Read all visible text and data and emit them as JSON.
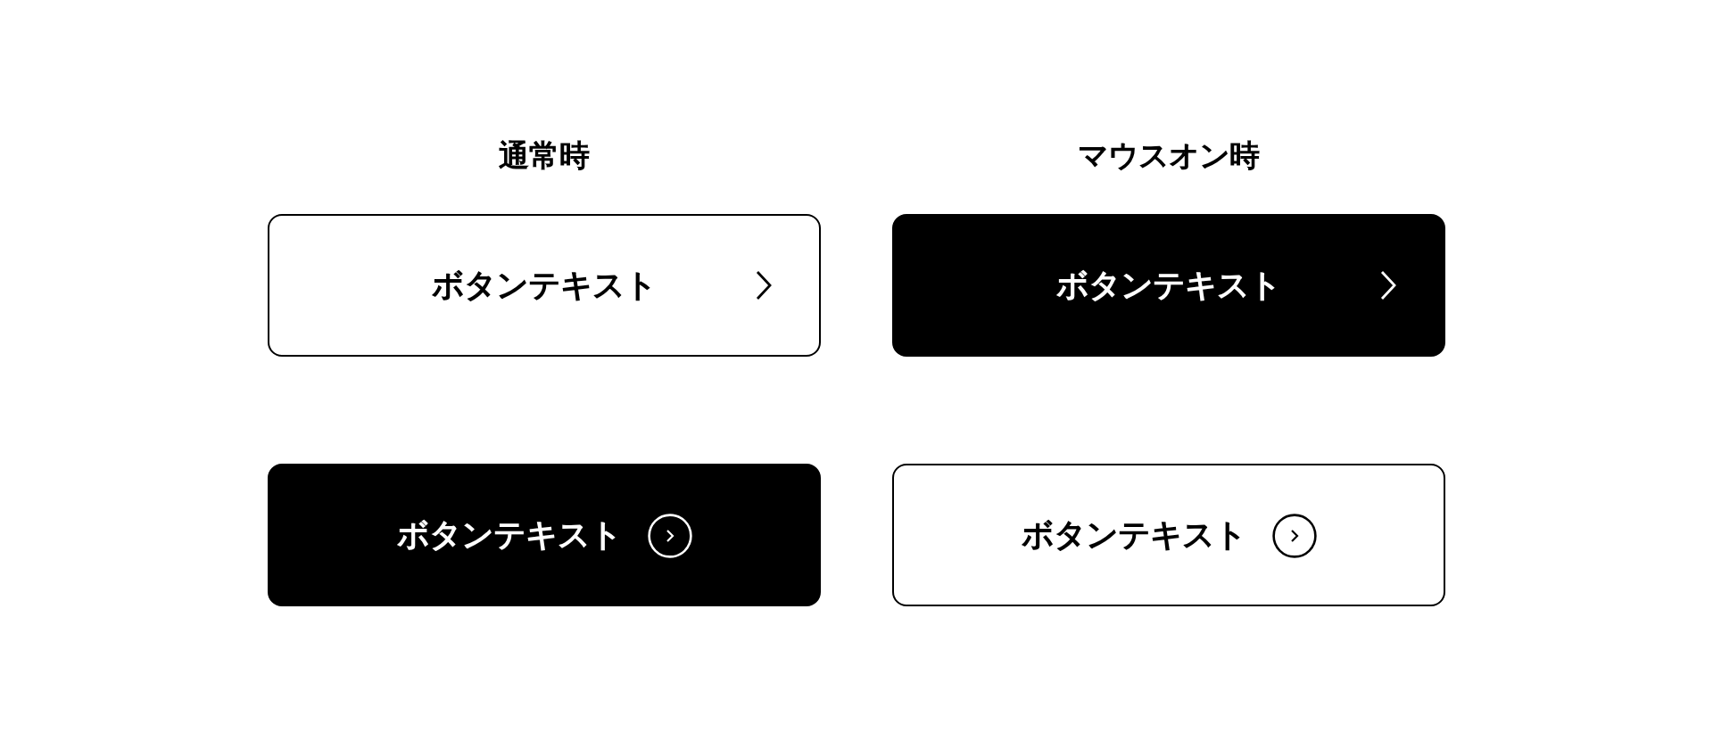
{
  "columns": [
    {
      "heading": "通常時"
    },
    {
      "heading": "マウスオン時"
    }
  ],
  "rows": [
    {
      "buttons": [
        {
          "label": "ボタンテキスト",
          "filled": false,
          "kind": "chevron"
        },
        {
          "label": "ボタンテキスト",
          "filled": true,
          "kind": "chevron"
        }
      ]
    },
    {
      "buttons": [
        {
          "label": "ボタンテキスト",
          "filled": true,
          "kind": "circle"
        },
        {
          "label": "ボタンテキスト",
          "filled": false,
          "kind": "circle"
        }
      ]
    }
  ]
}
